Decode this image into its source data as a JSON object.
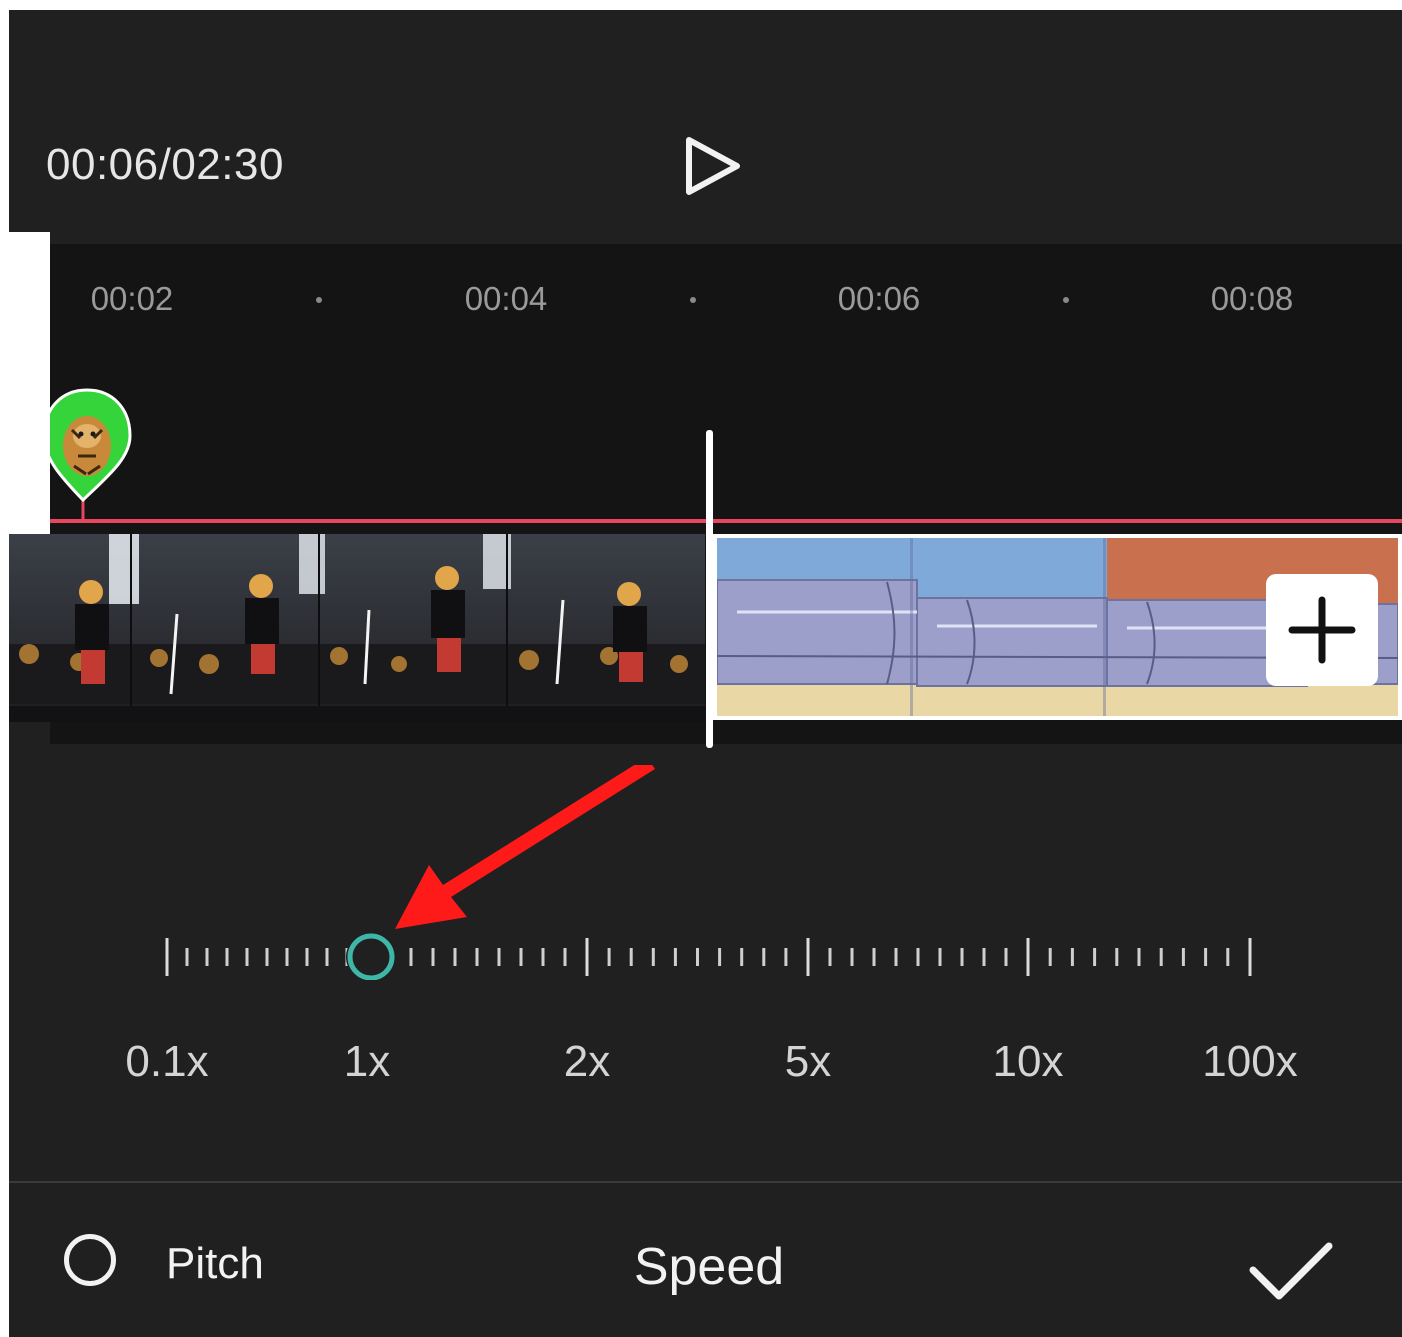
{
  "header": {
    "time_readout": "00:06/02:30",
    "play_icon": "play-icon"
  },
  "ruler": {
    "labels": [
      "00:02",
      "00:04",
      "00:06",
      "00:08"
    ]
  },
  "timeline": {
    "sticker_icon": "tiger-sticker-icon",
    "add_clip_icon": "plus-icon",
    "accent_color": "#e8455e"
  },
  "speed_slider": {
    "labels": [
      "0.1x",
      "1x",
      "2x",
      "5x",
      "10x",
      "100x"
    ],
    "selected": "1x",
    "handle_color": "#3fb7a8"
  },
  "bottom_bar": {
    "pitch_label": "Pitch",
    "title": "Speed",
    "confirm_icon": "checkmark-icon"
  }
}
